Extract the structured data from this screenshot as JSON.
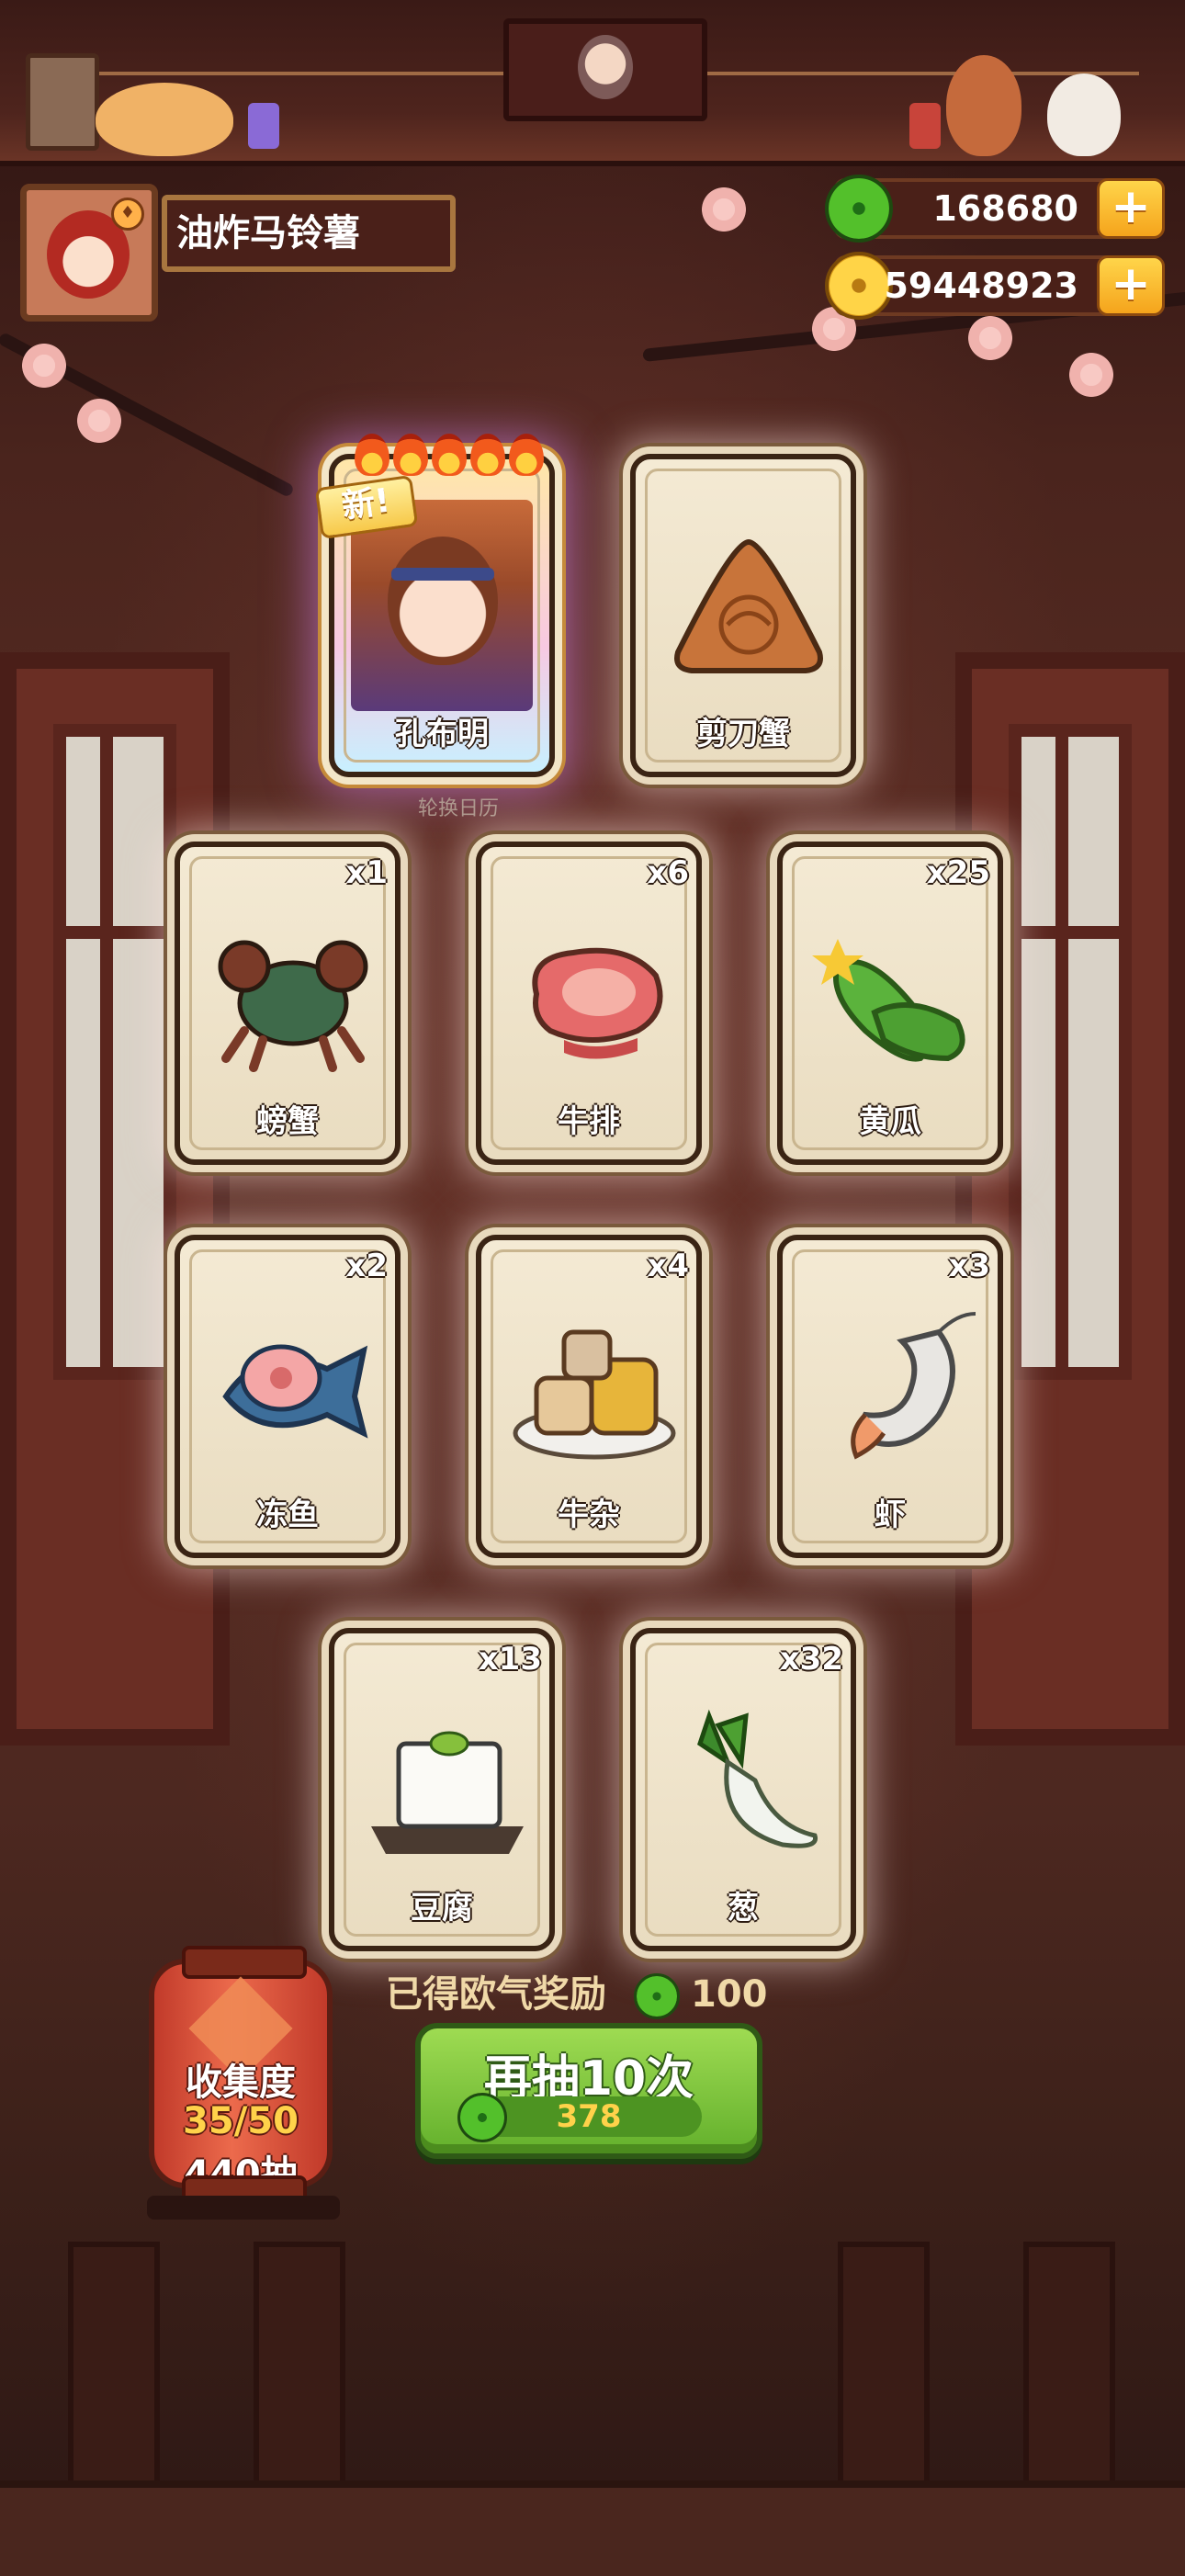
{
  "player": {
    "name": "油炸马铃薯",
    "avatar_icon": "player-avatar"
  },
  "currency": {
    "jade": "168680",
    "coins": "59448923",
    "plus_label": "+"
  },
  "hero_card": {
    "name": "孔布明",
    "new_tag": "新!",
    "flames": 5,
    "caption": "轮换日历"
  },
  "special_card": {
    "name": "剪刀蟹"
  },
  "cards": [
    {
      "name": "螃蟹",
      "count": "x1",
      "icon": "crab-icon"
    },
    {
      "name": "牛排",
      "count": "x6",
      "icon": "steak-icon"
    },
    {
      "name": "黄瓜",
      "count": "x25",
      "icon": "cucumber-icon"
    },
    {
      "name": "冻鱼",
      "count": "x2",
      "icon": "fish-icon"
    },
    {
      "name": "牛杂",
      "count": "x4",
      "icon": "beef-offal-icon"
    },
    {
      "name": "虾",
      "count": "x3",
      "icon": "shrimp-icon"
    },
    {
      "name": "豆腐",
      "count": "x13",
      "icon": "tofu-icon"
    },
    {
      "name": "葱",
      "count": "x32",
      "icon": "scallion-icon"
    }
  ],
  "collection": {
    "title": "收集度",
    "progress": "35/50",
    "draws": "440抽"
  },
  "reward": {
    "label": "已得欧气奖励",
    "value": "100"
  },
  "draw_button": {
    "label": "再抽10次",
    "cost": "378"
  },
  "colors": {
    "accent_green": "#63b02c",
    "gold": "#ffd24a",
    "card_bg": "#f4ead4",
    "wood": "#4a241d"
  }
}
